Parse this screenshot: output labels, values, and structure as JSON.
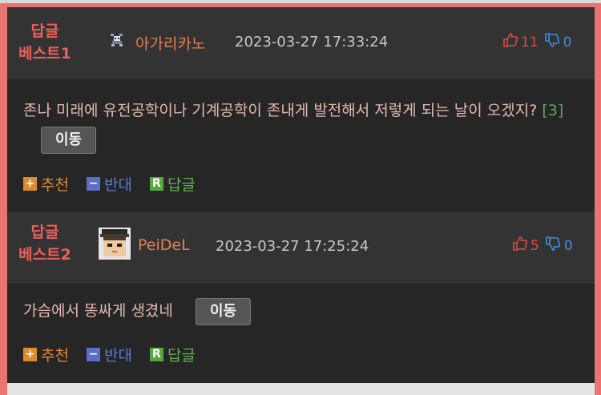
{
  "comments": [
    {
      "best_label_1": "답글",
      "best_label_2": "베스트1",
      "nickname": "아가리카노",
      "date": "2023-03-27 17:33:24",
      "upvotes": "11",
      "downvotes": "0",
      "text": "존나 미래에 유전공학이나 기계공학이 존내게 발전해서 저렇게 되는 날이 오겠지?",
      "ref": "[3]",
      "move_label": "이동",
      "avatar_icon": "character-icon"
    },
    {
      "best_label_1": "답글",
      "best_label_2": "베스트2",
      "nickname": "PeiDeL",
      "date": "2023-03-27 17:25:24",
      "upvotes": "5",
      "downvotes": "0",
      "text": "가슴에서 똥싸게 생겼네",
      "move_label": "이동",
      "avatar_icon": "pixel-face-icon"
    }
  ],
  "actions": {
    "recommend": "추천",
    "oppose": "반대",
    "reply": "답글"
  },
  "icons": {
    "recommend": "+",
    "oppose": "−",
    "reply": "R"
  },
  "colors": {
    "best": "#ef5f5b",
    "nickname": "#e57f52",
    "up": "#e04a44",
    "down": "#3d8fe0"
  }
}
